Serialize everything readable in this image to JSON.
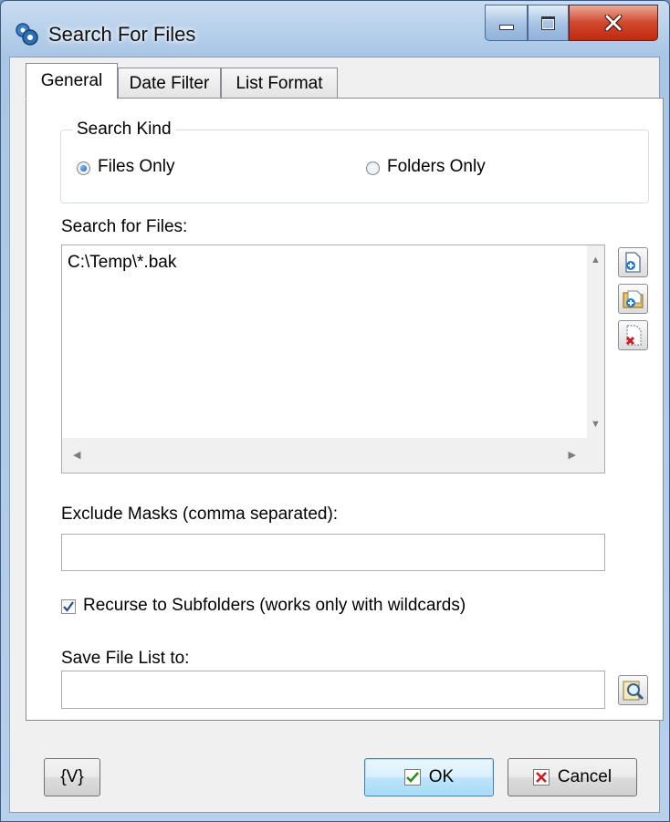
{
  "window": {
    "title": "Search For Files"
  },
  "tabs": [
    {
      "label": "General"
    },
    {
      "label": "Date Filter"
    },
    {
      "label": "List Format"
    }
  ],
  "search_kind": {
    "group_label": "Search Kind",
    "options": [
      {
        "label": "Files Only",
        "selected": true
      },
      {
        "label": "Folders Only",
        "selected": false
      }
    ]
  },
  "search_files": {
    "label": "Search for Files:",
    "items": [
      "C:\\Temp\\*.bak"
    ]
  },
  "exclude_masks": {
    "label": "Exclude Masks (comma separated):",
    "value": ""
  },
  "recurse": {
    "label": "Recurse to Subfolders (works only with wildcards)",
    "checked": true
  },
  "save_list": {
    "label": "Save File List to:",
    "value": ""
  },
  "buttons": {
    "variables": "{V}",
    "ok": "OK",
    "cancel": "Cancel"
  },
  "icons": {
    "app": "search-files-gears-icon",
    "add_file": "add-file-icon",
    "add_folder": "add-folder-icon",
    "delete": "delete-item-icon",
    "browse": "browse-magnifier-icon"
  },
  "colors": {
    "ok_check": "#2e8b1e",
    "cancel_x": "#d8191b",
    "selection": "#1c5fb0"
  }
}
